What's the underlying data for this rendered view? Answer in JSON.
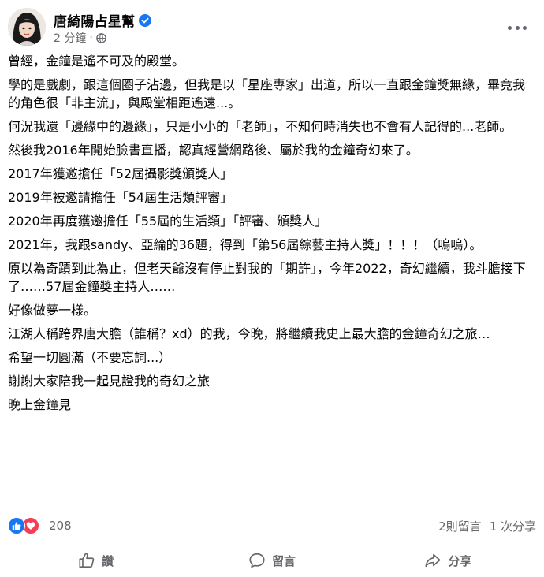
{
  "post": {
    "author": "唐綺陽占星幫",
    "time": "2 分鐘",
    "dot": "·",
    "paragraphs": [
      "曾經，金鐘是遙不可及的殿堂。",
      "學的是戲劇，跟這個圈子沾邊，但我是以「星座專家」出道，所以一直跟金鐘獎無緣，畢竟我的角色很「非主流」，與殿堂相距遙遠...。",
      "何況我還「邊緣中的邊緣」，只是小小的「老師」，不知何時消失也不會有人記得的...老師。",
      "然後我2016年開始臉書直播，認真經營網路後、屬於我的金鐘奇幻來了。",
      "2017年獲邀擔任「52屆攝影獎頒獎人」",
      "2019年被邀請擔任「54屆生活類評審」",
      "2020年再度獲邀擔任「55屆的生活類」「評審、頒獎人」",
      "2021年，我跟sandy、亞綸的36題，得到「第56屆綜藝主持人獎」！！！（嗚嗚）。",
      "原以為奇蹟到此為止，但老天爺沒有停止對我的「期許」，今年2022，奇幻繼續，我斗膽接下了……57屆金鐘獎主持人……",
      "好像做夢一樣。",
      "江湖人稱跨界唐大膽（誰稱？xd）的我，今晚，將繼續我史上最大膽的金鐘奇幻之旅…",
      "希望一切圓滿（不要忘詞...）",
      "謝謝大家陪我一起見證我的奇幻之旅",
      "晚上金鐘見"
    ],
    "reactions": {
      "count": "208",
      "icons": [
        "like-icon",
        "love-icon"
      ]
    },
    "comments": "2則留言",
    "shares": "1 次分享"
  },
  "actions": {
    "like": "讚",
    "comment": "留言",
    "share": "分享"
  },
  "colors": {
    "brand_blue": "#1877f2",
    "love_red": "#f33e58",
    "secondary_text": "#65676b"
  }
}
